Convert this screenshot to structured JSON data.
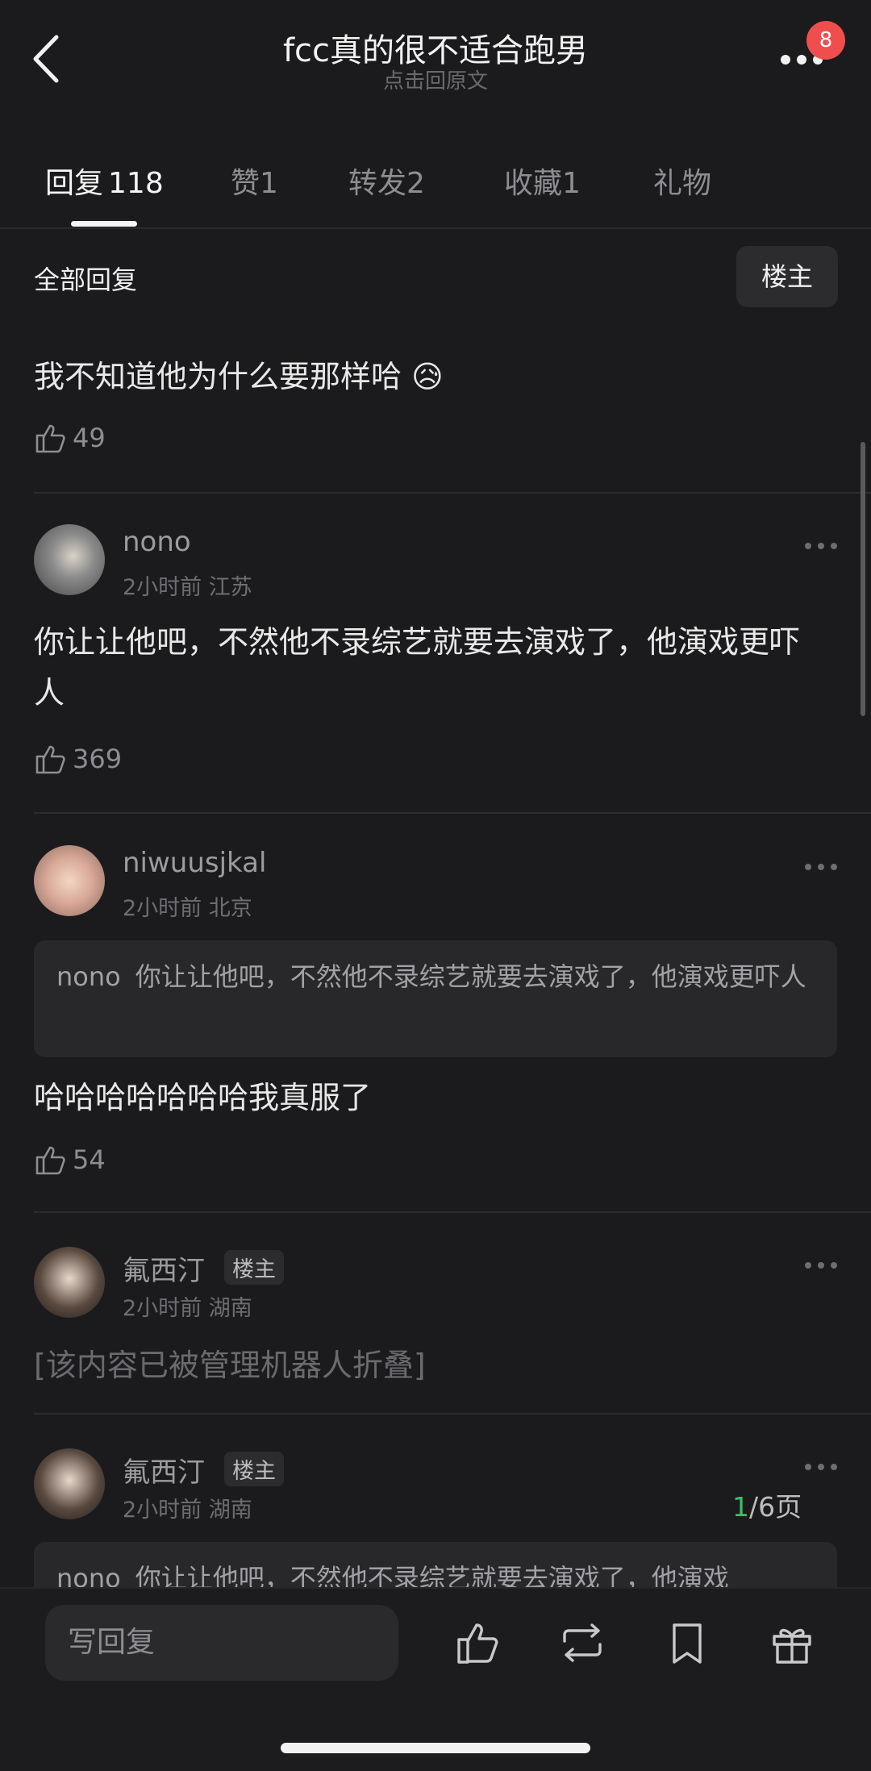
{
  "header": {
    "title": "fcc真的很不适合跑男",
    "subtitle": "点击回原文",
    "badge": "8"
  },
  "tabs": [
    {
      "label": "回复",
      "count": "118"
    },
    {
      "label": "赞",
      "count": "1"
    },
    {
      "label": "转发",
      "count": "2"
    },
    {
      "label": "收藏",
      "count": "1"
    },
    {
      "label": "礼物",
      "count": ""
    }
  ],
  "filter": {
    "label": "全部回复",
    "op_only": "楼主"
  },
  "comments": [
    {
      "content": "我不知道他为什么要那样哈",
      "emoji": "😥",
      "likes": "49"
    },
    {
      "username": "nono",
      "meta": "2小时前 江苏",
      "content": "你让让他吧，不然他不录综艺就要去演戏了，他演戏更吓人",
      "likes": "369"
    },
    {
      "username": "niwuusjkal",
      "meta": "2小时前 北京",
      "quote_user": "nono",
      "quote_text": "你让让他吧，不然他不录综艺就要去演戏了，他演戏更吓人",
      "content": "哈哈哈哈哈哈哈我真服了",
      "likes": "54"
    },
    {
      "username": "氟西汀",
      "tag": "楼主",
      "meta": "2小时前 湖南",
      "content": "[该内容已被管理机器人折叠]"
    },
    {
      "username": "氟西汀",
      "tag": "楼主",
      "meta": "2小时前 湖南",
      "quote_user": "nono",
      "quote_text": "你让让他吧，不然他不录综艺就要去演戏了，他演戏"
    }
  ],
  "pager": {
    "current": "1",
    "total": "/6页"
  },
  "bottom": {
    "reply_placeholder": "写回复"
  },
  "colors": {
    "background": "#1b1b1d",
    "badge": "#f04e4e",
    "page_current": "#39c264"
  }
}
